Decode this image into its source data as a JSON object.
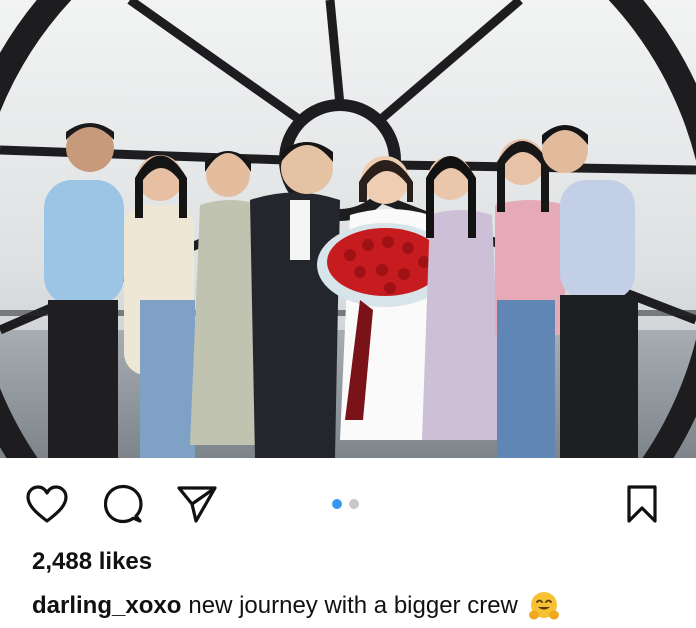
{
  "post": {
    "image_alt": "Group photo of eight people in front of a large clock window, bride holding a bouquet of red roses",
    "slide_count": 2,
    "active_slide": 1,
    "likes_text": "2,488 likes",
    "username": "darling_xoxo",
    "caption": "new journey with a bigger crew",
    "caption_emoji": "hugging-face-emoji"
  },
  "icons": {
    "like": "heart-icon",
    "comment": "comment-bubble-icon",
    "share": "paper-plane-icon",
    "save": "bookmark-icon"
  },
  "colors": {
    "icon": "#111111",
    "dot_active": "#3897f0",
    "dot_inactive": "#c8c8c8",
    "text": "#111111"
  }
}
